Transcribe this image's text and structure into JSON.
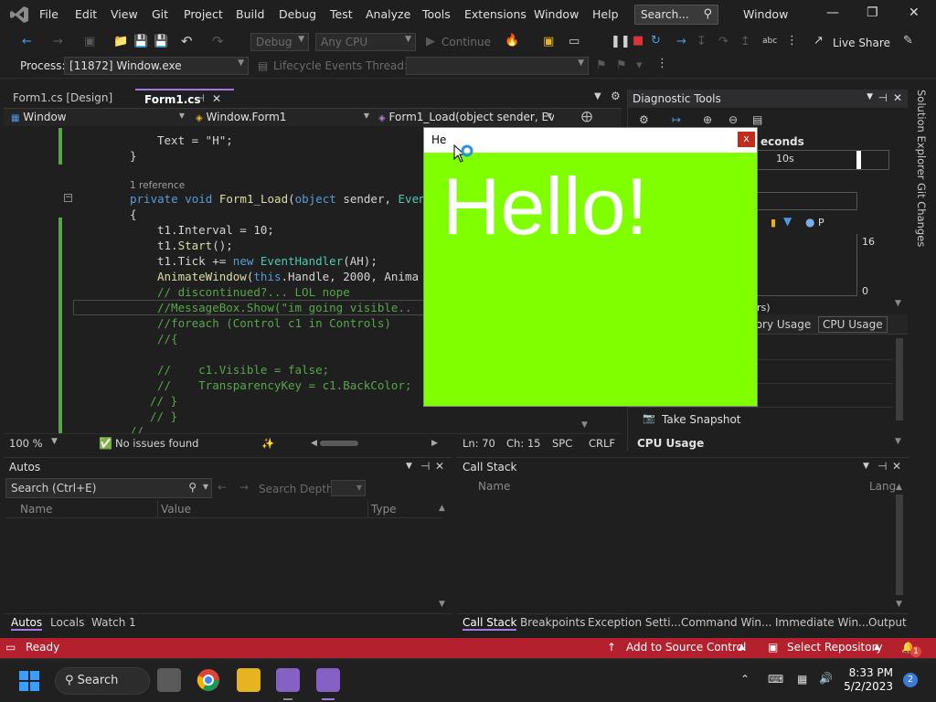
{
  "menubar": {
    "items": [
      "File",
      "Edit",
      "View",
      "Git",
      "Project",
      "Build",
      "Debug",
      "Test",
      "Analyze",
      "Tools",
      "Extensions",
      "Window",
      "Help"
    ],
    "search_placeholder": "Search...",
    "window_title": "Window"
  },
  "toolbar": {
    "config_combo": "Debug",
    "platform_combo": "Any CPU",
    "continue_label": "Continue",
    "live_share_label": "Live Share",
    "process_label": "Process:",
    "process_value": "[11872] Window.exe",
    "lifecycle_label": "Lifecycle Events",
    "thread_label": "Thread:"
  },
  "tabs": {
    "design_tab": "Form1.cs [Design]",
    "code_tab": "Form1.cs"
  },
  "nav": {
    "project": "Window",
    "class": "Window.Form1",
    "member": "Form1_Load(object sender, Eve"
  },
  "code": {
    "l1": "Text = \"H\";",
    "l2": "}",
    "ref": "1 reference",
    "l3a": "private void ",
    "l3b": "Form1_Load",
    "l3c": "(",
    "l3d": "object",
    "l3e": " sender, ",
    "l3f": "Even",
    "l4": "{",
    "l5": "t1.Interval = 10;",
    "l6a": "t1.",
    "l6b": "Start",
    "l6c": "();",
    "l7a": "t1.Tick += ",
    "l7b": "new ",
    "l7c": "EventHandler",
    "l7d": "(AH);",
    "l8a": "AnimateWindow",
    "l8b": "(",
    "l8c": "this",
    "l8d": ".Handle, 2000, Anima",
    "l9": "// discontinued?... LOL nope",
    "l10": "//MessageBox.Show(\"im going visible..",
    "l11": "//foreach (Control c1 in Controls)",
    "l12": "//{",
    "l13": "//    c1.Visible = false;",
    "l14": "//    TransparencyKey = c1.BackColor;",
    "l15": "// }",
    "l16": "// }",
    "l17": "//"
  },
  "editor_status": {
    "zoom": "100 %",
    "issues": "No issues found",
    "line": "Ln: 70",
    "col": "Ch: 15",
    "spc": "SPC",
    "crlf": "CRLF"
  },
  "diagnostics": {
    "title": "Diagnostic Tools",
    "seconds": "econds",
    "tick_10s": "10s",
    "axis_max": "16",
    "axis_min": "0",
    "legend_p": "P",
    "rs": "rs)",
    "tab_memory": "mory Usage",
    "tab_cpu": "CPU Usage",
    "snapshot": "Take Snapshot",
    "cpu_usage": "CPU Usage"
  },
  "side": {
    "solution_explorer": "Solution Explorer",
    "git_changes": "Git Changes"
  },
  "popup": {
    "title": "He",
    "close": "x",
    "hello": "Hello!"
  },
  "autos": {
    "title": "Autos",
    "search_placeholder": "Search (Ctrl+E)",
    "search_depth": "Search Depth:",
    "col_name": "Name",
    "col_value": "Value",
    "col_type": "Type",
    "tabs": [
      "Autos",
      "Locals",
      "Watch 1"
    ]
  },
  "callstack": {
    "title": "Call Stack",
    "col_name": "Name",
    "col_lang": "Lang",
    "tabs": [
      "Call Stack",
      "Breakpoints",
      "Exception Setti...",
      "Command Win...",
      "Immediate Win...",
      "Output"
    ]
  },
  "statusbar": {
    "ready": "Ready",
    "add_source": "Add to Source Control",
    "select_repo": "Select Repository",
    "notif_count": "1"
  },
  "taskbar": {
    "search": "Search",
    "time": "8:33 PM",
    "date": "5/2/2023",
    "badge": "2"
  }
}
